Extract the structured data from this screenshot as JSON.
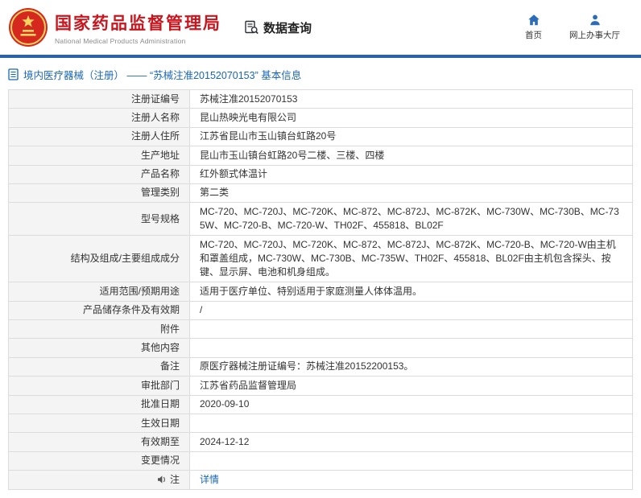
{
  "header": {
    "agency_cn": "国家药品监督管理局",
    "agency_en": "National Medical Products Administration",
    "section_title": "数据查询",
    "nav": {
      "home": "首页",
      "hall": "网上办事大厅"
    }
  },
  "breadcrumb": {
    "text": "境内医疗器械（注册） ——  “苏械注准20152070153”  基本信息"
  },
  "colors": {
    "red": "#c7161e",
    "accent-blue": "#2a63a7",
    "link-blue": "#1a66b3",
    "icon-blue": "#2b6cb8",
    "label-bg": "#f4f4f4",
    "border": "#dcdcdc"
  },
  "table": {
    "rows": [
      {
        "label": "注册证编号",
        "value": "苏械注准20152070153"
      },
      {
        "label": "注册人名称",
        "value": "昆山热映光电有限公司"
      },
      {
        "label": "注册人住所",
        "value": "江苏省昆山市玉山镇台虹路20号"
      },
      {
        "label": "生产地址",
        "value": "昆山市玉山镇台虹路20号二楼、三楼、四楼"
      },
      {
        "label": "产品名称",
        "value": "红外额式体温计"
      },
      {
        "label": "管理类别",
        "value": "第二类"
      },
      {
        "label": "型号规格",
        "value": "MC-720、MC-720J、MC-720K、MC-872、MC-872J、MC-872K、MC-730W、MC-730B、MC-735W、MC-720-B、MC-720-W、TH02F、455818、BL02F"
      },
      {
        "label": "结构及组成/主要组成成分",
        "value": "MC-720、MC-720J、MC-720K、MC-872、MC-872J、MC-872K、MC-720-B、MC-720-W由主机和罩盖组成，MC-730W、MC-730B、MC-735W、TH02F、455818、BL02F由主机包含探头、按键、显示屏、电池和机身组成。"
      },
      {
        "label": "适用范围/预期用途",
        "value": "适用于医疗单位、特别适用于家庭测量人体体温用。"
      },
      {
        "label": "产品储存条件及有效期",
        "value": "/"
      },
      {
        "label": "附件",
        "value": ""
      },
      {
        "label": "其他内容",
        "value": ""
      },
      {
        "label": "备注",
        "value": "原医疗器械注册证编号：苏械注准20152200153。"
      },
      {
        "label": "审批部门",
        "value": "江苏省药品监督管理局"
      },
      {
        "label": "批准日期",
        "value": "2020-09-10"
      },
      {
        "label": "生效日期",
        "value": ""
      },
      {
        "label": "有效期至",
        "value": "2024-12-12"
      },
      {
        "label": "变更情况",
        "value": ""
      },
      {
        "label": "注",
        "label_icon": "speaker-icon",
        "value": "详情",
        "link": true
      }
    ]
  }
}
